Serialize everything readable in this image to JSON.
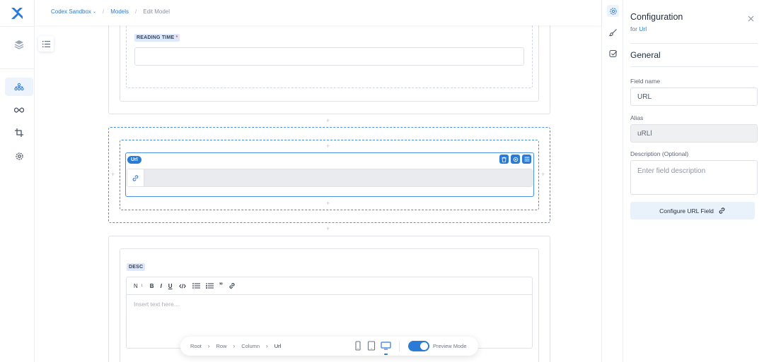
{
  "breadcrumb": {
    "project": "Codex Sandbox",
    "models": "Models",
    "current": "Edit Model"
  },
  "canvas": {
    "reading_time": {
      "label": "READING TIME",
      "required_mark": "*"
    },
    "url_field": {
      "tag": "Url"
    },
    "desc_field": {
      "label": "DESC",
      "format_select": "N",
      "toolbar": [
        "B",
        "I",
        "U"
      ],
      "placeholder": "Insert text here..."
    }
  },
  "bottom_bar": {
    "path": [
      "Root",
      "Row",
      "Column",
      "Url"
    ],
    "preview_label": "Preview Mode",
    "preview_on": true,
    "active_device": "desktop"
  },
  "panel": {
    "title": "Configuration",
    "subtitle_prefix": "for",
    "subtitle_link": "Url",
    "section": "General",
    "field_name_label": "Field name",
    "field_name_value": "URL",
    "alias_label": "Alias",
    "alias_value": "uRLl",
    "description_label": "Description (Optional)",
    "description_placeholder": "Enter field description",
    "configure_button": "Configure URL Field"
  },
  "colors": {
    "accent": "#2a7ad8",
    "label_bg": "#dde9fa"
  }
}
